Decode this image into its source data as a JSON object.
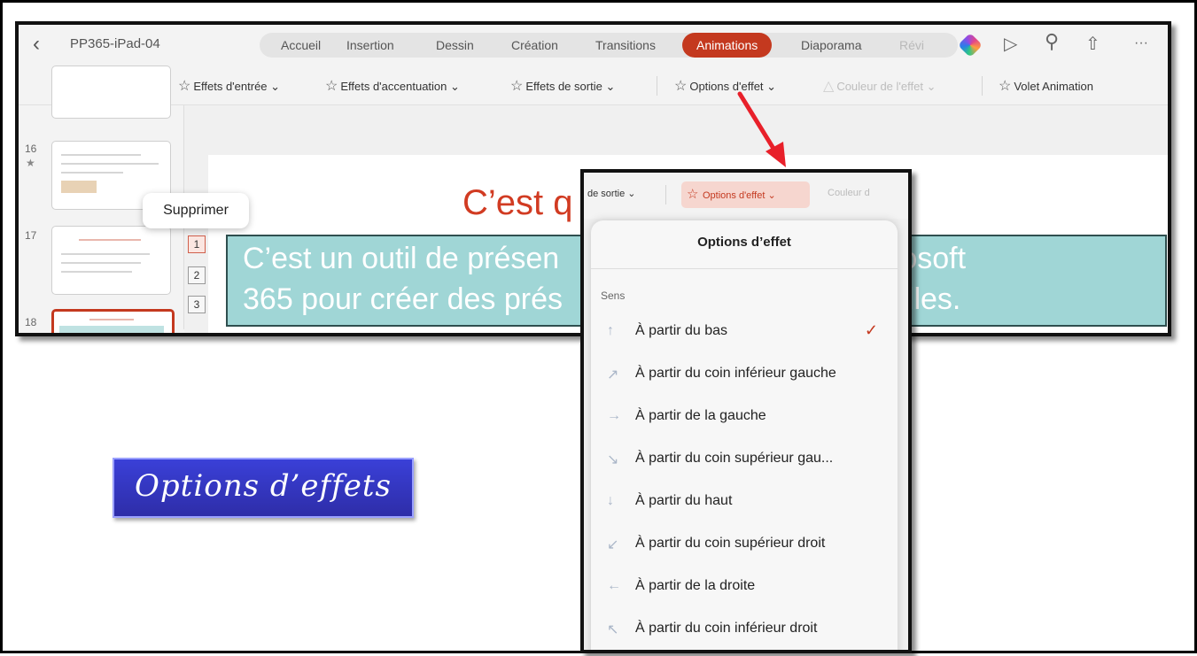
{
  "app": {
    "doc_title": "PP365-iPad-04",
    "tabs": [
      "Accueil",
      "Insertion",
      "Dessin",
      "Création",
      "Transitions",
      "Animations",
      "Diaporama",
      "Révi"
    ],
    "active_tab": "Animations"
  },
  "ribbon": {
    "effets_entree": "Effets d'entrée",
    "effets_accentuation": "Effets d'accentuation",
    "effets_sortie": "Effets de sortie",
    "options_effet": "Options d'effet",
    "couleur_effet": "Couleur de l'effet",
    "volet_animation": "Volet Animation",
    "chevron": "⌄"
  },
  "thumbnails": {
    "numbers": [
      "16",
      "17",
      "18"
    ],
    "star": "★"
  },
  "tooltip": "Supprimer",
  "anim_numbers": [
    "1",
    "2",
    "3"
  ],
  "slide": {
    "title": "C’est q",
    "line1a": "C’est un outil de présen",
    "line1b": "rosoft",
    "line2a": "365 pour créer des prés",
    "line2b": "elles."
  },
  "label": "Options d’effets",
  "dropdown_bar": {
    "de_sortie": "de sortie ⌄",
    "options_effet": "Options d'effet ⌄",
    "couleur": "Couleur d"
  },
  "dropdown": {
    "title": "Options d’effet",
    "section": "Sens",
    "options": [
      {
        "arrow": "↑",
        "label": "À partir du bas",
        "checked": "✓"
      },
      {
        "arrow": "↗",
        "label": "À partir du coin inférieur gauche",
        "checked": ""
      },
      {
        "arrow": "→",
        "label": "À partir de la gauche",
        "checked": ""
      },
      {
        "arrow": "↘",
        "label": "À partir du coin supérieur gau...",
        "checked": ""
      },
      {
        "arrow": "↓",
        "label": "À partir du haut",
        "checked": ""
      },
      {
        "arrow": "↙",
        "label": "À partir du coin supérieur droit",
        "checked": ""
      },
      {
        "arrow": "←",
        "label": "À partir de la droite",
        "checked": ""
      },
      {
        "arrow": "↖",
        "label": "À partir du coin inférieur droit",
        "checked": ""
      }
    ]
  },
  "colors": {
    "accent": "#c4391f",
    "slide_title": "#d13b22",
    "textbox": "#a0d6d6",
    "label_bg": "#3a40d8",
    "arrow": "#e8202a"
  }
}
